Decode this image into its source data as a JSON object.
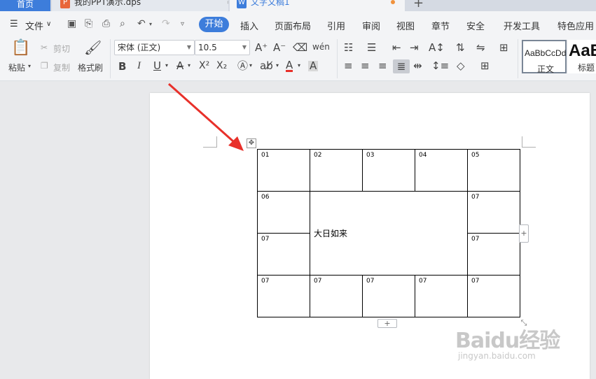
{
  "tabs": {
    "home": "首页",
    "ppt": "我的PPT演示.dps",
    "ppt_icon": "P",
    "doc": "文字文稿1",
    "doc_icon": "W",
    "new": "+"
  },
  "menu": {
    "file": "文件",
    "start": "开始",
    "items": [
      "插入",
      "页面布局",
      "引用",
      "审阅",
      "视图",
      "章节",
      "安全",
      "开发工具",
      "特色应用"
    ]
  },
  "ribbon": {
    "paste": "粘贴",
    "cut": "剪切",
    "copy": "复制",
    "format_painter": "格式刷",
    "font_name": "宋体 (正文)",
    "font_size": "10.5",
    "bold": "B",
    "italic": "I",
    "underline": "U",
    "superscript": "X²",
    "subscript": "X₂",
    "style1_sample": "AaBbCcDd",
    "style1_label": "正文",
    "style2_sample": "AaB",
    "style2_label": "标题"
  },
  "table": {
    "rows": [
      [
        "01",
        "02",
        "03",
        "04",
        "05"
      ],
      [
        "06",
        "",
        "",
        "",
        "07"
      ],
      [
        "07",
        "",
        "",
        "",
        "07"
      ],
      [
        "07",
        "07",
        "07",
        "07",
        "07"
      ]
    ],
    "merged_text": "大日如来",
    "c00": "01",
    "c01": "02",
    "c02": "03",
    "c03": "04",
    "c04": "05",
    "c10": "06",
    "c14": "07",
    "c20": "07",
    "c24": "07",
    "c30": "07",
    "c31": "07",
    "c32": "07",
    "c33": "07",
    "c34": "07"
  },
  "watermark": {
    "brand": "Baidu经验",
    "url": "jingyan.baidu.com"
  },
  "colors": {
    "accent": "#3d7ddb",
    "arrow": "#e8302a"
  }
}
